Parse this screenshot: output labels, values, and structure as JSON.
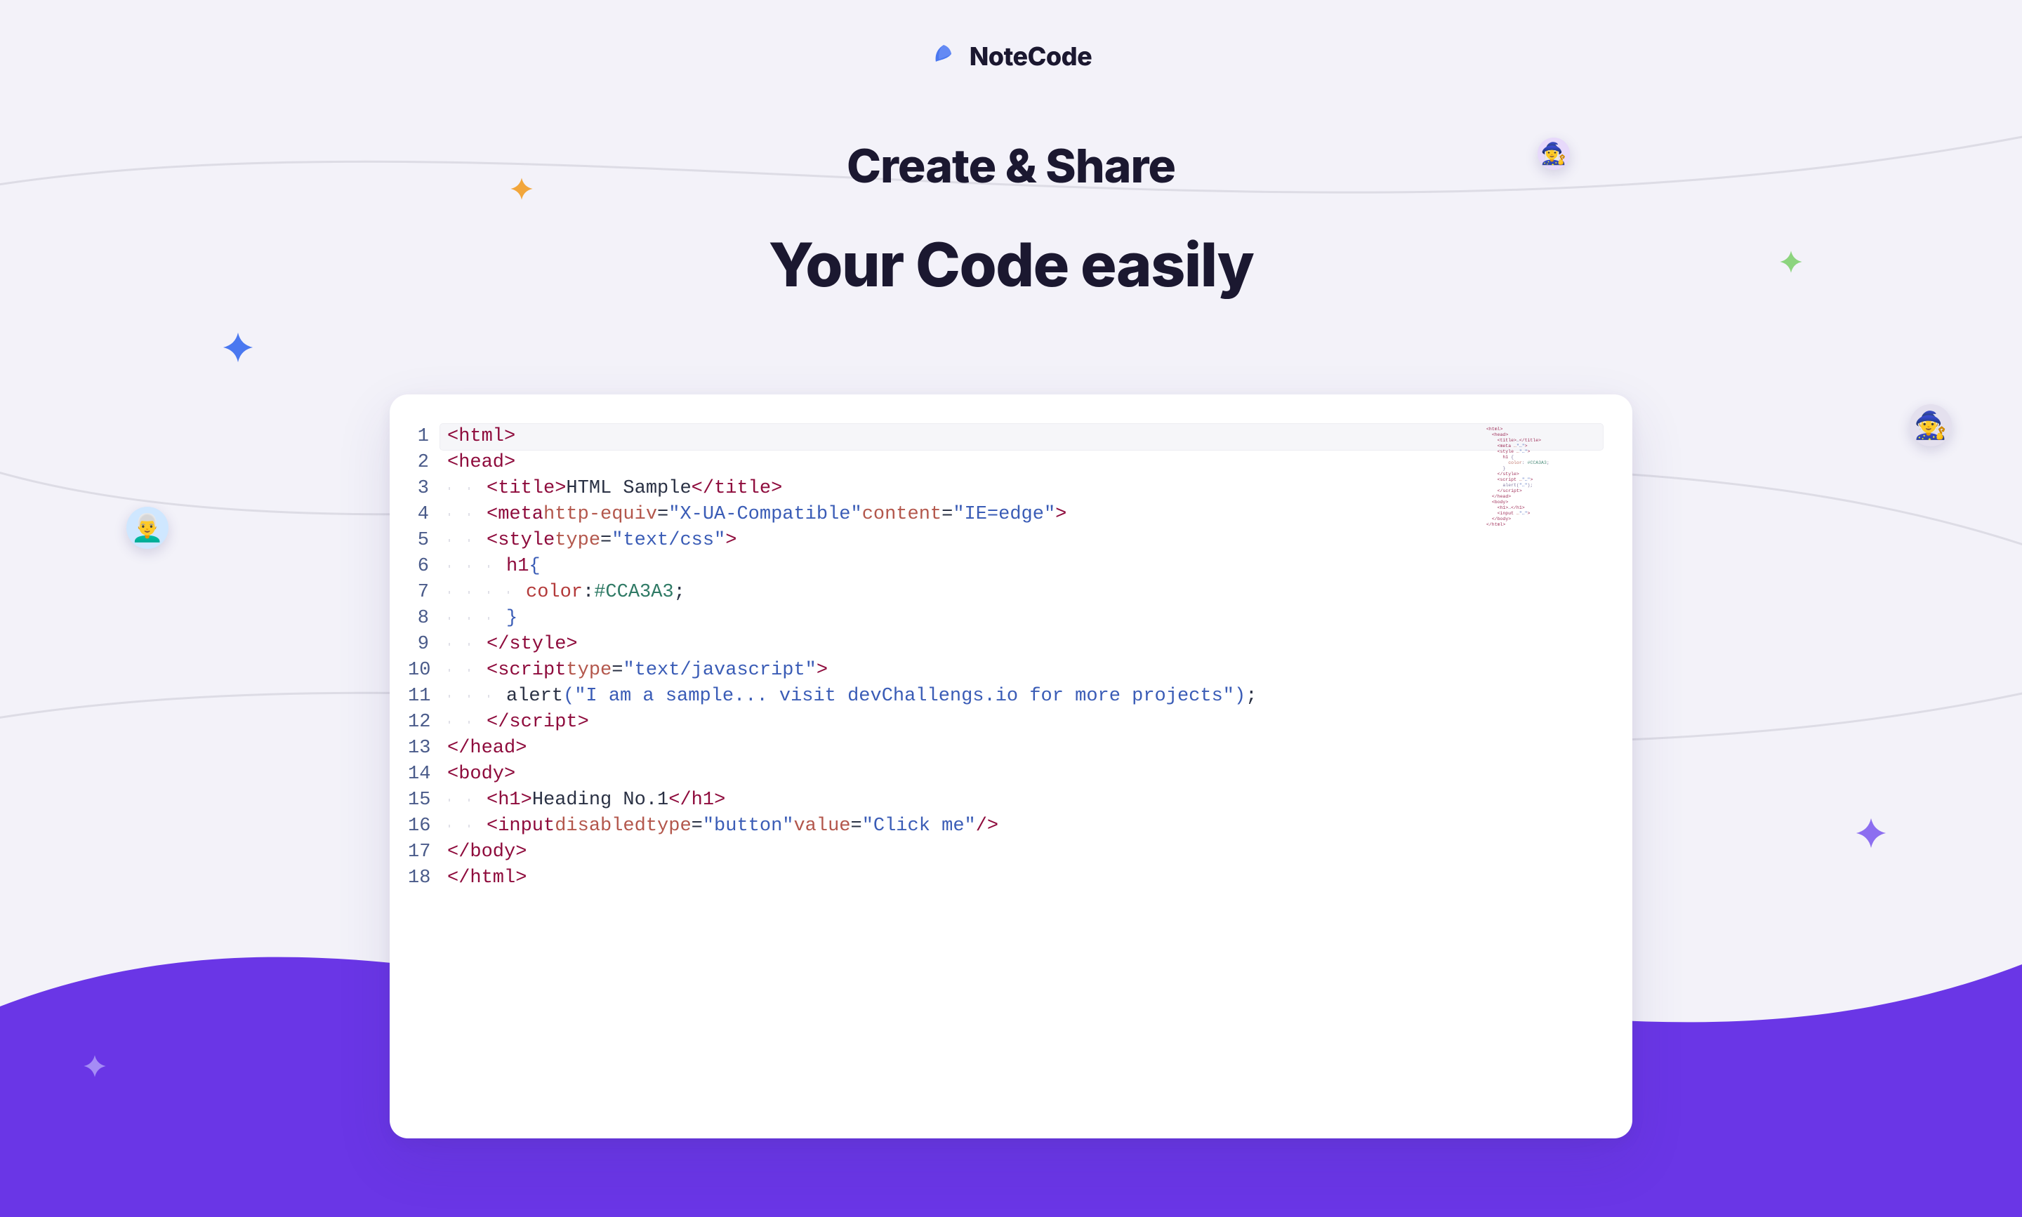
{
  "brand": {
    "name": "NoteCode"
  },
  "headline": {
    "line1": "Create & Share",
    "line2": "Your Code easily"
  },
  "editor": {
    "current_line": 1,
    "lines": [
      {
        "n": 1,
        "indent": 0,
        "kind": "open",
        "tag": "html"
      },
      {
        "n": 2,
        "indent": 1,
        "kind": "open",
        "tag": "head"
      },
      {
        "n": 3,
        "indent": 2,
        "kind": "wrap",
        "tag": "title",
        "text": "HTML Sample"
      },
      {
        "n": 4,
        "indent": 2,
        "kind": "self",
        "tag": "meta",
        "attrs": [
          [
            "http-equiv",
            "X-UA-Compatible"
          ],
          [
            "content",
            "IE=edge"
          ]
        ]
      },
      {
        "n": 5,
        "indent": 2,
        "kind": "open",
        "tag": "style",
        "attrs": [
          [
            "type",
            "text/css"
          ]
        ]
      },
      {
        "n": 6,
        "indent": 3,
        "kind": "cssopen",
        "selector": "h1"
      },
      {
        "n": 7,
        "indent": 4,
        "kind": "cssdecl",
        "prop": "color",
        "value": "#CCA3A3"
      },
      {
        "n": 8,
        "indent": 3,
        "kind": "cssclose"
      },
      {
        "n": 9,
        "indent": 2,
        "kind": "close",
        "tag": "style"
      },
      {
        "n": 10,
        "indent": 2,
        "kind": "open",
        "tag": "script",
        "attrs": [
          [
            "type",
            "text/javascript"
          ]
        ]
      },
      {
        "n": 11,
        "indent": 3,
        "kind": "js",
        "fn": "alert",
        "arg": "I am a sample... visit devChallengs.io for more projects"
      },
      {
        "n": 12,
        "indent": 2,
        "kind": "close",
        "tag": "script"
      },
      {
        "n": 13,
        "indent": 1,
        "kind": "close",
        "tag": "head"
      },
      {
        "n": 14,
        "indent": 1,
        "kind": "open",
        "tag": "body"
      },
      {
        "n": 15,
        "indent": 2,
        "kind": "wrap",
        "tag": "h1",
        "text": "Heading No.1"
      },
      {
        "n": 16,
        "indent": 2,
        "kind": "self",
        "tag": "input",
        "flags": [
          "disabled"
        ],
        "attrs": [
          [
            "type",
            "button"
          ],
          [
            "value",
            "Click me"
          ]
        ],
        "selfclose": true
      },
      {
        "n": 17,
        "indent": 1,
        "kind": "close",
        "tag": "body"
      },
      {
        "n": 18,
        "indent": 0,
        "kind": "close",
        "tag": "html"
      }
    ]
  },
  "avatars": {
    "top": {
      "emoji": "🧙‍♀️",
      "bg": "#e7d9fb"
    },
    "left": {
      "emoji": "👨‍🦳",
      "bg": "#cfe7ff"
    },
    "right": {
      "emoji": "🧙",
      "bg": "#e4e0ee"
    }
  },
  "sparkles": {
    "blue": "#4a78f0",
    "orange": "#f2a63b",
    "green": "#8cd47e",
    "purple": "#8c6ef0",
    "lilac": "#a58cf5"
  }
}
